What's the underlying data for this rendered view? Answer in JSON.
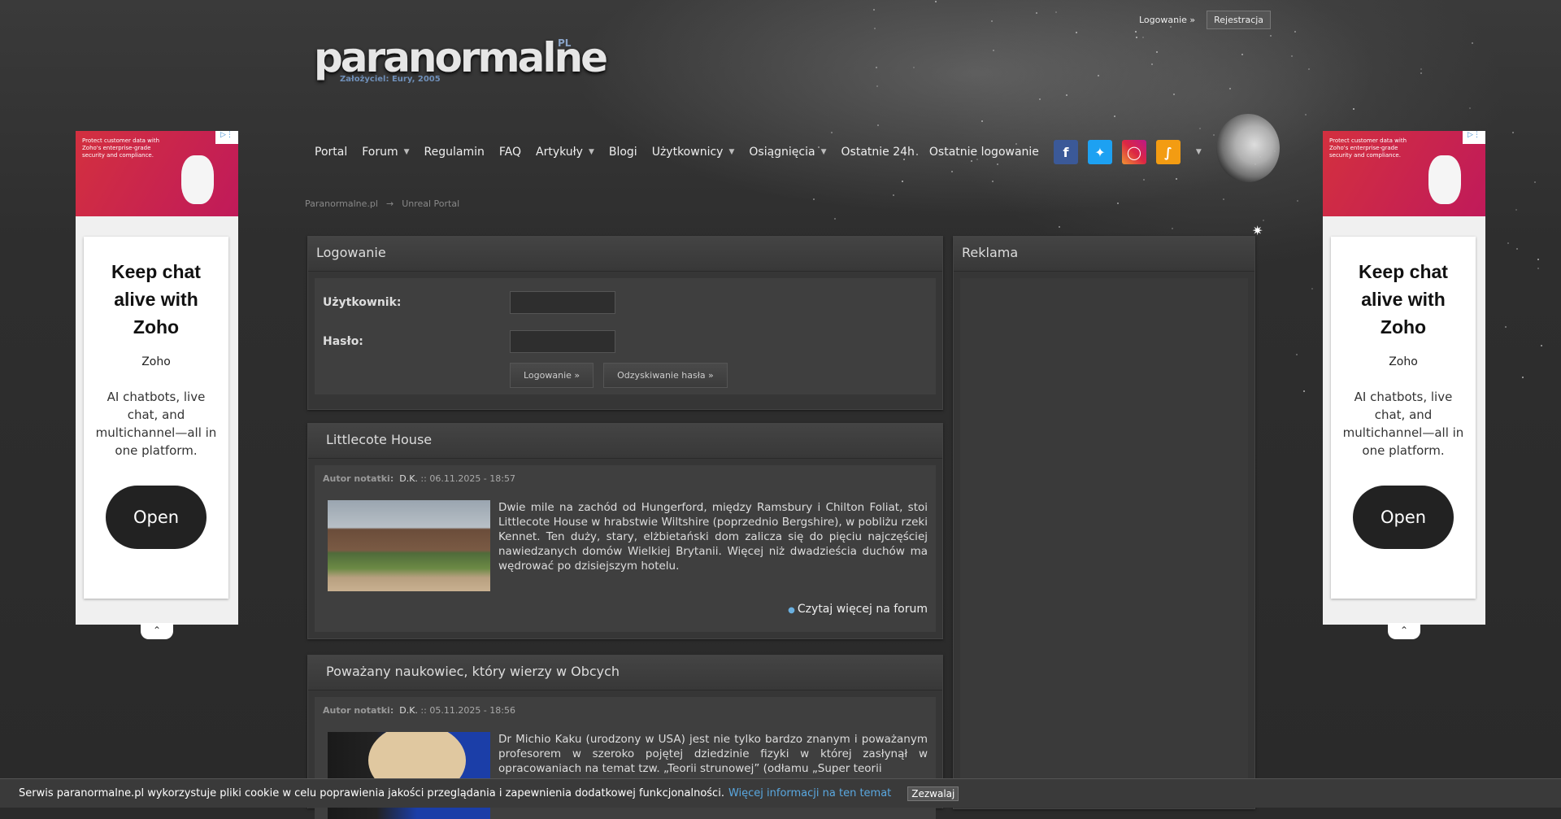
{
  "top": {
    "login": "Logowanie »",
    "register": "Rejestracja"
  },
  "logo": {
    "name": "paranormalne",
    "pl": "PL",
    "founder": "Założyciel: Eury, 2005"
  },
  "nav": {
    "items": [
      {
        "label": "Portal",
        "dropdown": false
      },
      {
        "label": "Forum",
        "dropdown": true
      },
      {
        "label": "Regulamin",
        "dropdown": false
      },
      {
        "label": "FAQ",
        "dropdown": false
      },
      {
        "label": "Artykuły",
        "dropdown": true
      },
      {
        "label": "Blogi",
        "dropdown": false
      },
      {
        "label": "Użytkownicy",
        "dropdown": true
      },
      {
        "label": "Osiągnięcia",
        "dropdown": true
      },
      {
        "label": "Ostatnie 24h",
        "dropdown": false
      },
      {
        "label": "Ostatnie logowanie",
        "dropdown": false
      }
    ],
    "socials": [
      "facebook-icon",
      "twitter-icon",
      "instagram-icon",
      "rss-icon"
    ]
  },
  "breadcrumb": {
    "home": "Paranormalne.pl",
    "sep": "→",
    "current": "Unreal Portal"
  },
  "login": {
    "title": "Logowanie",
    "user_label": "Użytkownik:",
    "pass_label": "Hasło:",
    "login_btn": "Logowanie »",
    "recover_btn": "Odzyskiwanie hasła »"
  },
  "ads_panel": {
    "title": "Reklama"
  },
  "articles": [
    {
      "title": "Littlecote House",
      "meta_label": "Autor notatki:",
      "author": "D.K.",
      "date": ":: 06.11.2025 - 18:57",
      "text": "Dwie mile na zachód od Hungerford, między Ramsbury i Chilton Foliat, stoi Littlecote House w hrabstwie Wiltshire (poprzednio Bergshire), w pobliżu rzeki Kennet. Ten duży, stary, elżbietański dom zalicza się do pięciu najczęściej nawiedzanych domów Wielkiej Brytanii. Więcej niż dwadzieścia duchów ma wędrować po dzisiejszym hotelu.",
      "readmore": "Czytaj więcej na forum"
    },
    {
      "title": "Poważany naukowiec, który wierzy w Obcych",
      "meta_label": "Autor notatki:",
      "author": "D.K.",
      "date": ":: 05.11.2025 - 18:56",
      "text": "Dr Michio Kaku (urodzony w USA) jest nie tylko bardzo znanym i poważanym profesorem w szeroko pojętej dziedzinie fizyki w której zasłynął w opracowaniach na temat tzw. „Teorii strunowej” (odłamu „Super teorii"
    }
  ],
  "side_ad": {
    "banner_text": "Protect customer data with Zoho's enterprise-grade security and compliance.",
    "headline": "Keep chat alive with Zoho",
    "brand": "Zoho",
    "desc": "AI chatbots, live chat, and multichannel—all in one platform.",
    "cta": "Open"
  },
  "cookie": {
    "text": "Serwis paranormalne.pl wykorzystuje pliki cookie w celu poprawienia jakości przeglądania i zapewnienia dodatkowej funkcjonalności.",
    "more": "Więcej informacji na ten temat",
    "allow": "Zezwalaj"
  }
}
